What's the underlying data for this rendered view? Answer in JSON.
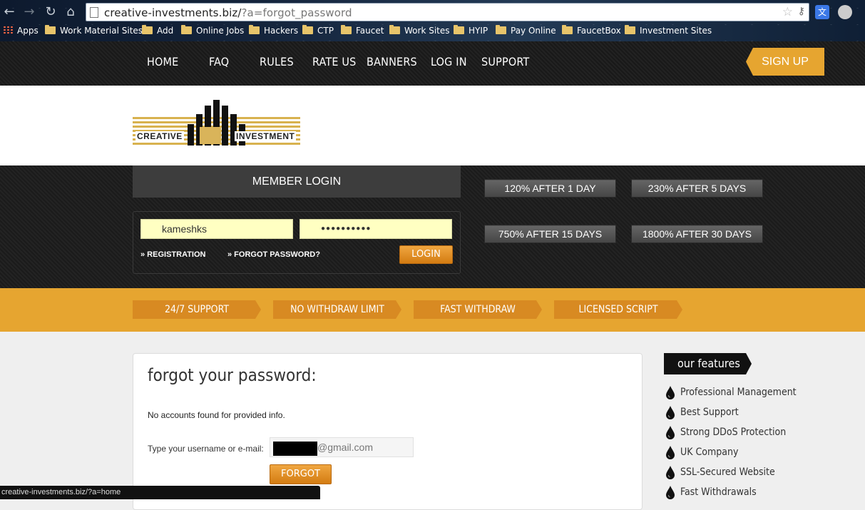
{
  "browser": {
    "url_host": "creative-investments.biz/",
    "url_rest": "?a=forgot_password",
    "bookmarks": [
      "Apps",
      "Work Material Sites",
      "Add",
      "Online Jobs",
      "Hackers",
      "CTP",
      "Faucet",
      "Work Sites",
      "HYIP",
      "Pay Online",
      "FaucetBox",
      "Investment Sites"
    ],
    "status_url": "creative-investments.biz/?a=home"
  },
  "nav": {
    "items": [
      "HOME",
      "FAQ",
      "RULES",
      "RATE US",
      "BANNERS",
      "LOG IN",
      "SUPPORT"
    ],
    "signup": "SIGN UP"
  },
  "logo": {
    "word1": "CREATIVE",
    "word2": "INVESTMENT"
  },
  "login": {
    "title": "MEMBER LOGIN",
    "username": "kameshks",
    "password": "●●●●●●●●●●",
    "registration": "» REGISTRATION",
    "forgot": "» FORGOT PASSWORD?",
    "button": "LOGIN"
  },
  "plans": [
    "120% AFTER 1 DAY",
    "230% AFTER 5 DAYS",
    "750% AFTER 15 DAYS",
    "1800% AFTER 30 DAYS"
  ],
  "features_band": [
    "24/7 SUPPORT",
    "NO WITHDRAW LIMIT",
    "FAST WITHDRAW",
    "LICENSED SCRIPT"
  ],
  "content": {
    "title": "forgot your password:",
    "message": "No accounts found for provided info.",
    "label": "Type your username or e-mail:",
    "email_value": "@gmail.com",
    "button": "FORGOT"
  },
  "sidebar": {
    "title": "our features",
    "items": [
      "Professional Management",
      "Best Support",
      "Strong DDoS Protection",
      "UK Company",
      "SSL-Secured Website",
      "Fast Withdrawals"
    ]
  },
  "colors": {
    "accent": "#e6a530",
    "dark": "#1d1d1d",
    "input_bg": "#ffffc2"
  }
}
